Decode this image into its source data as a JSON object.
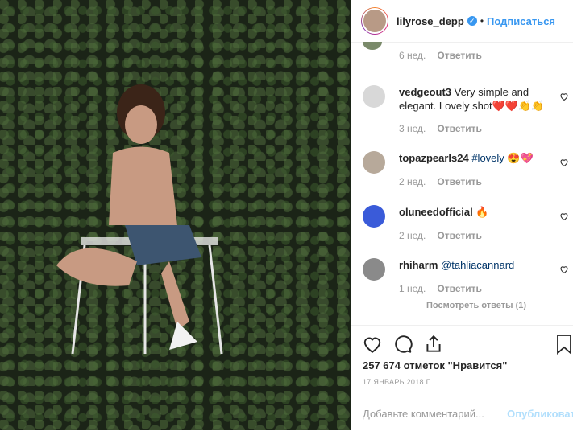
{
  "header": {
    "username": "lilyrose_depp",
    "verified_mark": "✓",
    "dot": "•",
    "follow_label": "Подписаться"
  },
  "comments": [
    {
      "meta_time": "6 нед.",
      "reply_label": "Ответить"
    },
    {
      "username": "vedgeout3",
      "text": "Very simple and elegant. Lovely shot❤️❤️👏👏",
      "meta_time": "3 нед.",
      "reply_label": "Ответить"
    },
    {
      "username": "topazpearls24",
      "text": "#lovely 😍💖",
      "meta_time": "2 нед.",
      "reply_label": "Ответить"
    },
    {
      "username": "oluneedofficial",
      "text": "🔥",
      "meta_time": "2 нед.",
      "reply_label": "Ответить"
    },
    {
      "username": "rhiharm",
      "text": "@tahliacannard",
      "meta_time": "1 нед.",
      "reply_label": "Ответить"
    }
  ],
  "view_replies": "Посмотреть ответы (1)",
  "likes": "257 674 отметок \"Нравится\"",
  "date": "17 ЯНВАРЬ 2018 Г.",
  "add_comment_placeholder": "Добавьте комментарий...",
  "publish_label": "Опубликовать",
  "colors": {
    "link": "#3897f0",
    "muted": "#999999",
    "border": "#efefef"
  }
}
